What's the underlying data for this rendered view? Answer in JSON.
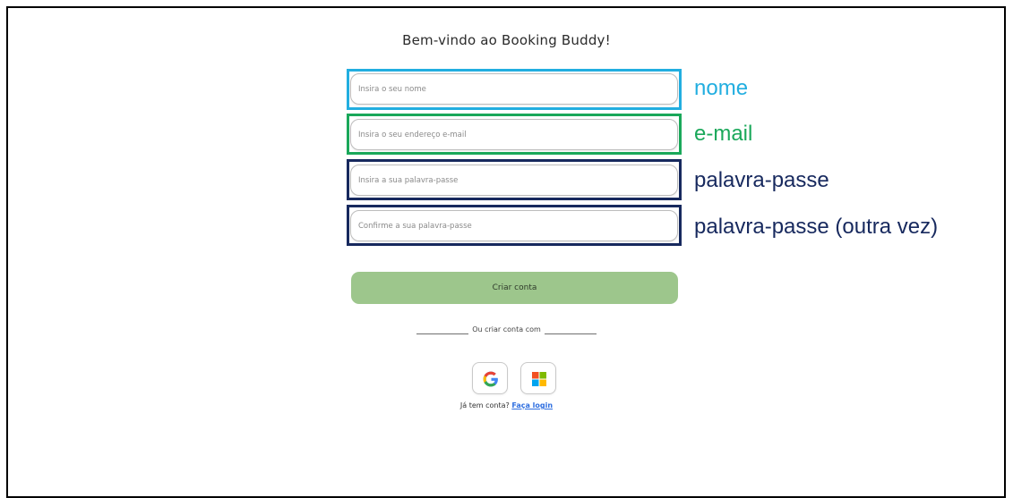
{
  "page": {
    "title": "Bem-vindo ao Booking Buddy!"
  },
  "form": {
    "name_placeholder": "Insira o seu nome",
    "email_placeholder": "Insira o seu endereço e-mail",
    "password_placeholder": "Insira a sua palavra-passe",
    "confirm_password_placeholder": "Confirme a sua palavra-passe",
    "create_button": "Criar conta"
  },
  "annotations": {
    "name": {
      "label": "nome",
      "color": "#22aee0"
    },
    "email": {
      "label": "e-mail",
      "color": "#1aa85a"
    },
    "password": {
      "label": "palavra-passe",
      "color": "#17295e"
    },
    "confirm_password": {
      "label": "palavra-passe (outra vez)",
      "color": "#17295e"
    }
  },
  "alt_signup": {
    "divider_text": "Ou criar conta com",
    "providers": [
      {
        "icon": "google-icon"
      },
      {
        "icon": "microsoft-icon"
      }
    ]
  },
  "login_prompt": {
    "text": "Já tem conta?",
    "link": "Faça login"
  },
  "colors": {
    "create_button_bg": "#9dc68c",
    "link": "#2f6fe0"
  }
}
